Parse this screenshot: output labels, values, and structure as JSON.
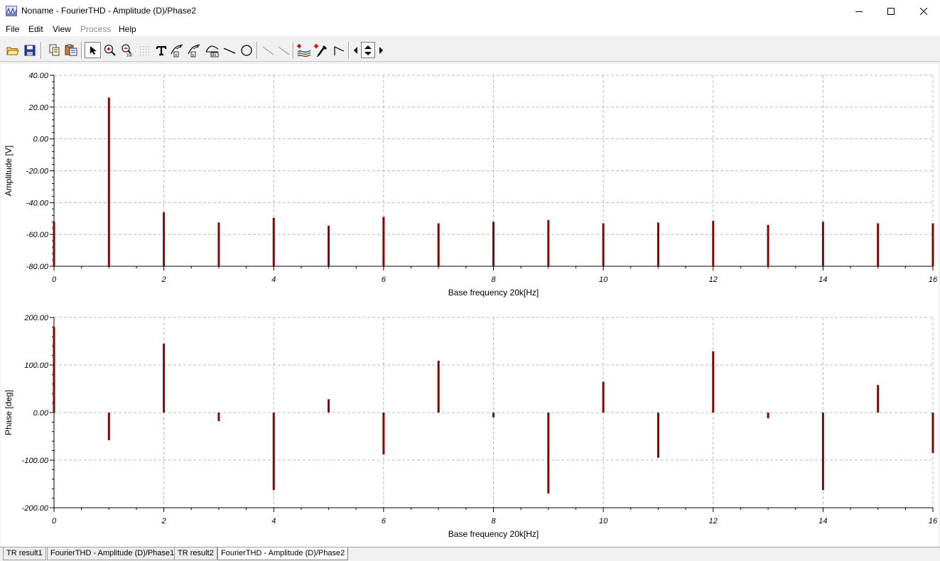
{
  "window": {
    "title": "Noname - FourierTHD - Amplitude (D)/Phase2"
  },
  "menu": [
    "File",
    "Edit",
    "View",
    "Process",
    "Help"
  ],
  "menu_disabled": [
    "Process"
  ],
  "toolbar_icons": [
    "open-folder-icon",
    "save-icon",
    "copy-icon",
    "paste-icon",
    "pointer-icon",
    "zoom-in-icon",
    "zoom-100-icon",
    "grid-icon",
    "text-icon",
    "curve-label-icon",
    "curve-label-2-icon",
    "curve-label-3-icon",
    "line-icon",
    "circle-icon",
    "slope-icon",
    "slope-2-icon",
    "add-curve-icon",
    "add-marker-icon",
    "peak-icon",
    "arrow-left-icon",
    "arrow-up-down-icon",
    "arrow-right-icon"
  ],
  "tabs": [
    {
      "label": "TR result1",
      "active": false
    },
    {
      "label": "FourierTHD - Amplitude (D)/Phase1",
      "active": false
    },
    {
      "label": "TR result2",
      "active": false
    },
    {
      "label": "FourierTHD - Amplitude (D)/Phase2",
      "active": true
    }
  ],
  "colors": {
    "bar": "#7a0a0a",
    "grid": "#b8b8b8"
  },
  "chart_data": [
    {
      "type": "bar",
      "xlabel": "Base frequency 20k[Hz]",
      "ylabel": "Amplitude [V]",
      "xlim": [
        0,
        16
      ],
      "ylim": [
        -80,
        40
      ],
      "xticks": [
        "0",
        "2",
        "4",
        "6",
        "8",
        "10",
        "12",
        "14",
        "16"
      ],
      "yticks": [
        "40.00",
        "20.00",
        "0.00",
        "-20.00",
        "-40.00",
        "-60.00",
        "-80.00"
      ],
      "baseline": -80,
      "x": [
        0,
        1,
        2,
        3,
        4,
        5,
        6,
        7,
        8,
        9,
        10,
        11,
        12,
        13,
        14,
        15,
        16
      ],
      "values": [
        -52,
        26,
        -46,
        -52.5,
        -49.5,
        -54.5,
        -49,
        -53,
        -52,
        -51,
        -53,
        -52.5,
        -51.5,
        -54,
        -52,
        -53,
        -53
      ]
    },
    {
      "type": "bar",
      "xlabel": "Base frequency 20k[Hz]",
      "ylabel": "Phase [deg]",
      "xlim": [
        0,
        16
      ],
      "ylim": [
        -200,
        200
      ],
      "xticks": [
        "0",
        "2",
        "4",
        "6",
        "8",
        "10",
        "12",
        "14",
        "16"
      ],
      "yticks": [
        "200.00",
        "100.00",
        "0.00",
        "-100.00",
        "-200.00"
      ],
      "baseline": 0,
      "x": [
        0,
        1,
        2,
        3,
        4,
        5,
        6,
        7,
        8,
        9,
        10,
        11,
        12,
        13,
        14,
        15,
        16
      ],
      "values": [
        180,
        -58,
        145,
        -18,
        -163,
        28,
        -88,
        109,
        -10,
        -170,
        65,
        -95,
        129,
        -12,
        -163,
        58,
        -85
      ]
    }
  ]
}
